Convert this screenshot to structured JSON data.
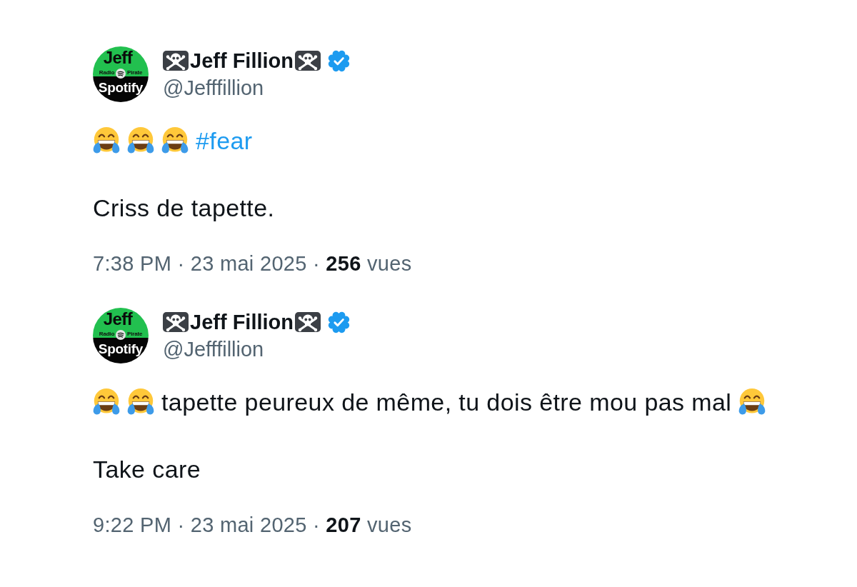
{
  "tweets": [
    {
      "avatar": {
        "title": "Jeff",
        "left_label": "Radio",
        "right_label": "Pirate",
        "caption": "Spotify"
      },
      "author": {
        "name": [
          {
            "kind": "skull"
          },
          {
            "kind": "text",
            "text": "Jeff Fillion"
          },
          {
            "kind": "skull"
          }
        ],
        "verified": true,
        "handle": "@Jefffillion"
      },
      "paragraphs": [
        [
          {
            "kind": "laugh"
          },
          {
            "kind": "laugh"
          },
          {
            "kind": "laugh"
          },
          {
            "kind": "hashtag",
            "text": "#fear"
          }
        ],
        [
          {
            "kind": "text",
            "text": "Criss de tapette."
          }
        ]
      ],
      "meta": "7:38 PM · 23 mai 2025 · **256** vues"
    },
    {
      "avatar": {
        "title": "Jeff",
        "left_label": "Radio",
        "right_label": "Pirate",
        "caption": "Spotify"
      },
      "author": {
        "name": [
          {
            "kind": "skull"
          },
          {
            "kind": "text",
            "text": "Jeff Fillion"
          },
          {
            "kind": "skull"
          }
        ],
        "verified": true,
        "handle": "@Jefffillion"
      },
      "paragraphs": [
        [
          {
            "kind": "laugh"
          },
          {
            "kind": "laugh"
          },
          {
            "kind": "text",
            "text": "tapette peureux de même, tu dois être mou pas mal"
          },
          {
            "kind": "laugh"
          }
        ],
        [
          {
            "kind": "text",
            "text": "Take care"
          }
        ]
      ],
      "meta": "9:22 PM · 23 mai 2025 · **207** vues"
    }
  ]
}
